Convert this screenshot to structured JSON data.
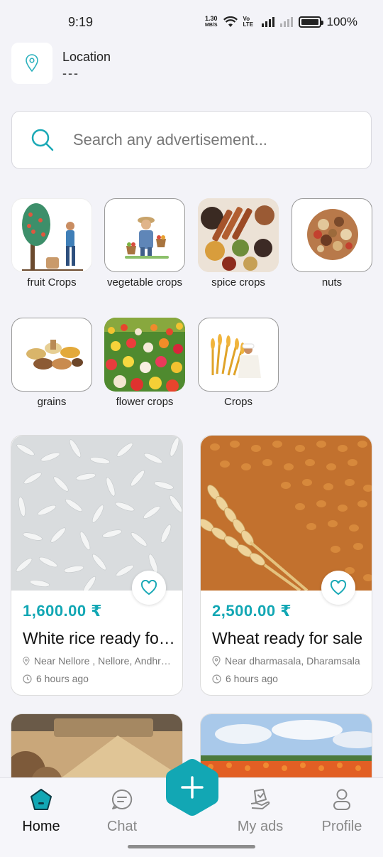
{
  "status_bar": {
    "time": "9:19",
    "net_speed_value": "1.30",
    "net_speed_unit": "MB/S",
    "volte": "Vo LTE",
    "battery": "100%"
  },
  "location": {
    "title": "Location",
    "value": "---"
  },
  "search": {
    "placeholder": "Search any advertisement..."
  },
  "categories": [
    {
      "label": "fruit Crops"
    },
    {
      "label": "vegetable crops"
    },
    {
      "label": "spice crops"
    },
    {
      "label": "nuts"
    },
    {
      "label": "grains"
    },
    {
      "label": "flower crops"
    },
    {
      "label": "Crops"
    }
  ],
  "listings": [
    {
      "price": "1,600.00 ₹",
      "title": "White rice ready for sale",
      "location": "Near Nellore , Nellore, Andhra Pradesh",
      "time": "6 hours ago"
    },
    {
      "price": "2,500.00 ₹",
      "title": "Wheat ready for sale",
      "location": "Near dharmasala, Dharamsala",
      "time": "6 hours ago"
    }
  ],
  "bottom_nav": {
    "home": "Home",
    "chat": "Chat",
    "my_ads": "My ads",
    "profile": "Profile"
  },
  "colors": {
    "accent": "#12a7b4",
    "background": "#f3f3f8"
  },
  "icons": {
    "location": "location-pin-icon",
    "search": "search-icon",
    "heart": "heart-icon",
    "add": "plus-icon"
  }
}
